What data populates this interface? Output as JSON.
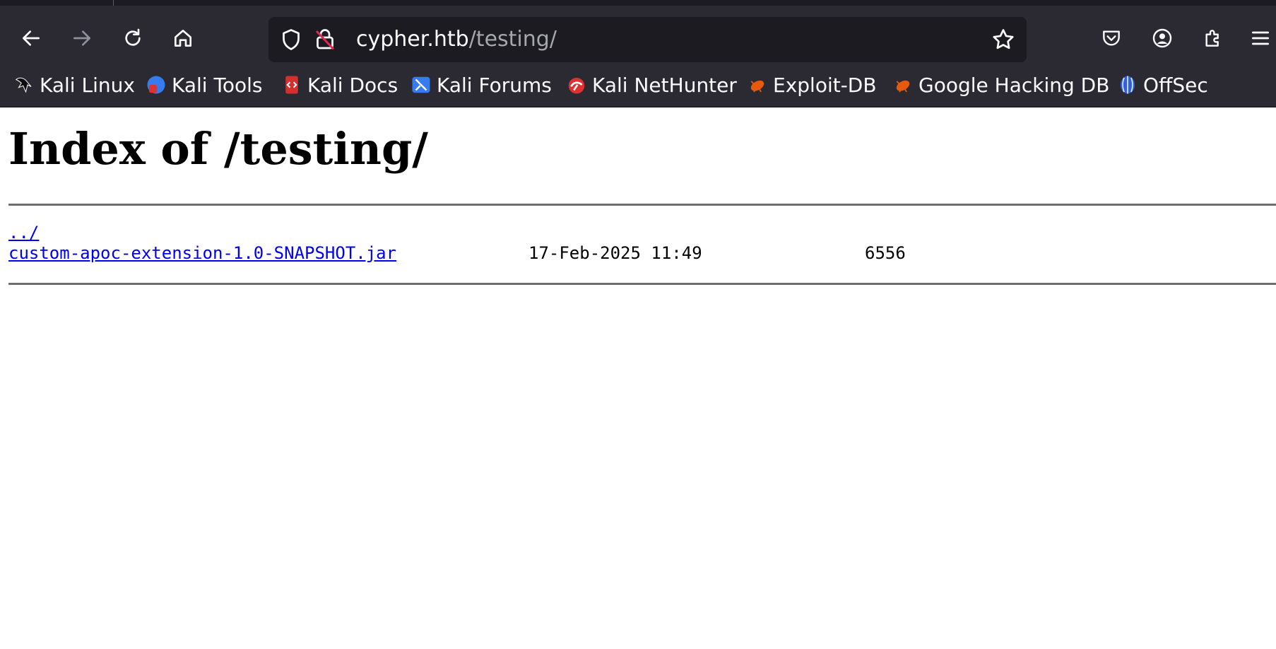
{
  "browser": {
    "url_host": "cypher.htb",
    "url_path": "/testing/",
    "bookmarks": [
      {
        "label": "Kali Linux",
        "icon": "kali-dragon-icon"
      },
      {
        "label": "Kali Tools",
        "icon": "kali-tools-icon"
      },
      {
        "label": "Kali Docs",
        "icon": "kali-docs-icon"
      },
      {
        "label": "Kali Forums",
        "icon": "kali-forums-icon"
      },
      {
        "label": "Kali NetHunter",
        "icon": "kali-nethunter-icon"
      },
      {
        "label": "Exploit-DB",
        "icon": "exploit-db-icon"
      },
      {
        "label": "Google Hacking DB",
        "icon": "ghdb-icon"
      },
      {
        "label": "OffSec",
        "icon": "offsec-icon"
      }
    ],
    "colors": {
      "chrome": "#2b2a33",
      "urlbar": "#1c1b22",
      "text": "#fbfbfe"
    }
  },
  "page": {
    "title": "Index of /testing/",
    "entries": [
      {
        "name": "../",
        "date": "",
        "size": ""
      },
      {
        "name": "custom-apoc-extension-1.0-SNAPSHOT.jar",
        "date": "17-Feb-2025 11:49",
        "size": "6556"
      }
    ],
    "link_color": "#0000ee"
  }
}
